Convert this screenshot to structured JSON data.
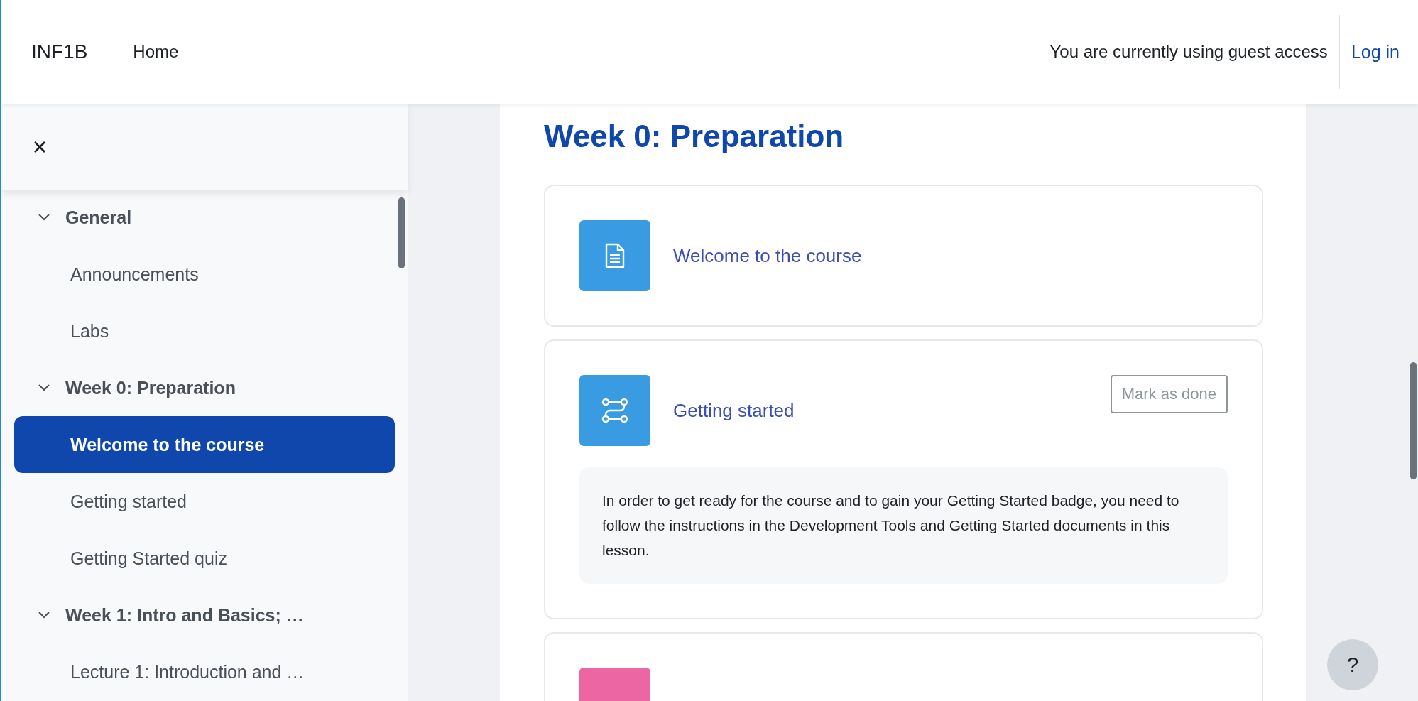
{
  "navbar": {
    "site_name": "INF1B",
    "links": [
      {
        "label": "Home"
      }
    ],
    "guest_notice": "You are currently using guest access",
    "login": "Log in"
  },
  "sidebar": {
    "sections": [
      {
        "title": "General",
        "expanded": true,
        "children": [
          {
            "label": "Announcements",
            "selected": false
          },
          {
            "label": "Labs",
            "selected": false
          }
        ]
      },
      {
        "title": "Week 0: Preparation",
        "expanded": true,
        "children": [
          {
            "label": "Welcome to the course",
            "selected": true
          },
          {
            "label": "Getting started",
            "selected": false
          },
          {
            "label": "Getting Started quiz",
            "selected": false
          }
        ]
      },
      {
        "title": "Week 1: Intro and Basics; …",
        "expanded": true,
        "children": [
          {
            "label": "Lecture 1: Introduction and …",
            "selected": false
          }
        ]
      }
    ]
  },
  "section": {
    "title": "Week 0: Preparation",
    "activities": [
      {
        "kind": "page",
        "title": "Welcome to the course",
        "color": "#399be2"
      },
      {
        "kind": "lesson",
        "title": "Getting started",
        "color": "#399be2",
        "completion_button": "Mark as done",
        "description": "In order to get ready for the course and to gain your Getting Started badge, you need to follow the instructions in the Development Tools and Getting Started documents in this lesson."
      },
      {
        "kind": "quiz",
        "color": "#eb66a2"
      }
    ]
  },
  "help": {
    "label": "?"
  }
}
